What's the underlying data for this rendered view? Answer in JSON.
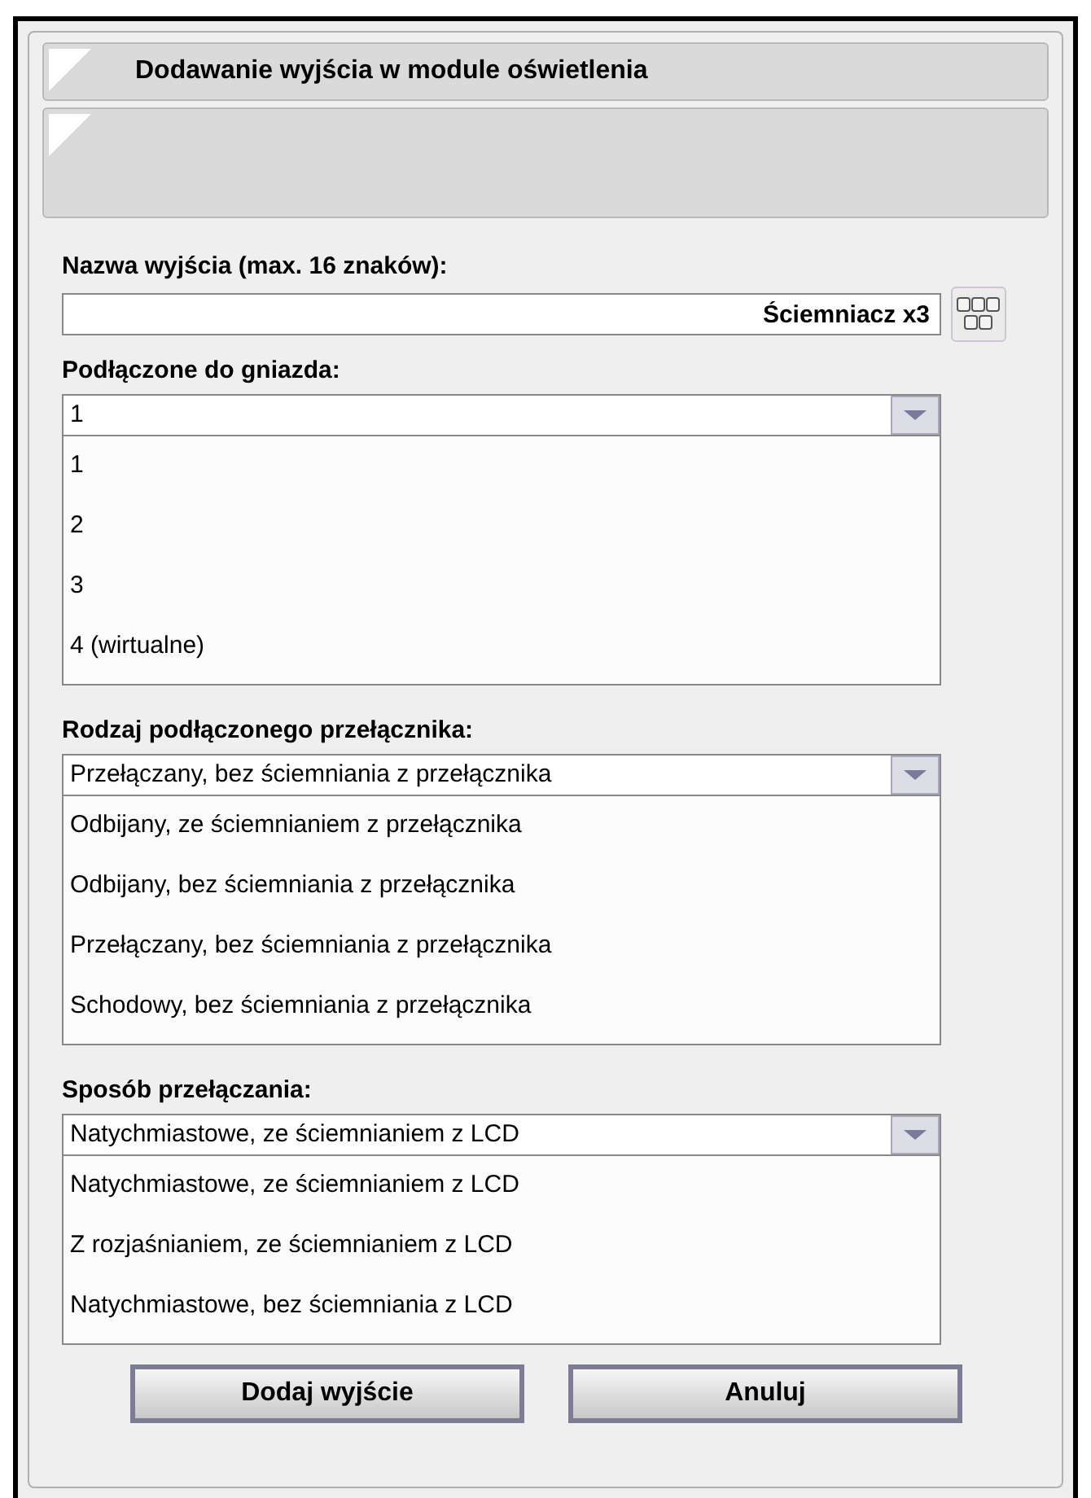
{
  "dialog": {
    "title": "Dodawanie wyjścia w module oświetlenia"
  },
  "name_field": {
    "label": "Nazwa wyjścia (max. 16 znaków):",
    "value": "Ściemniacz x3"
  },
  "dropdowns": [
    {
      "label": "Podłączone do gniazda:",
      "value": "1",
      "options": [
        "1",
        "2",
        "3",
        "4 (wirtualne)"
      ]
    },
    {
      "label": "Rodzaj podłączonego przełącznika:",
      "value": "Przełączany, bez ściemniania z przełącznika",
      "options": [
        "Odbijany, ze ściemnianiem z przełącznika",
        "Odbijany, bez ściemniania z przełącznika",
        "Przełączany, bez ściemniania z przełącznika",
        "Schodowy, bez ściemniania z przełącznika"
      ]
    },
    {
      "label": "Sposób przełączania:",
      "value": "Natychmiastowe, ze ściemnianiem z LCD",
      "options": [
        "Natychmiastowe, ze ściemnianiem z LCD",
        "Z rozjaśnianiem, ze ściemnianiem z LCD",
        "Natychmiastowe, bez ściemniania z LCD"
      ]
    }
  ],
  "buttons": [
    "Dodaj wyjście",
    "Anuluj"
  ]
}
